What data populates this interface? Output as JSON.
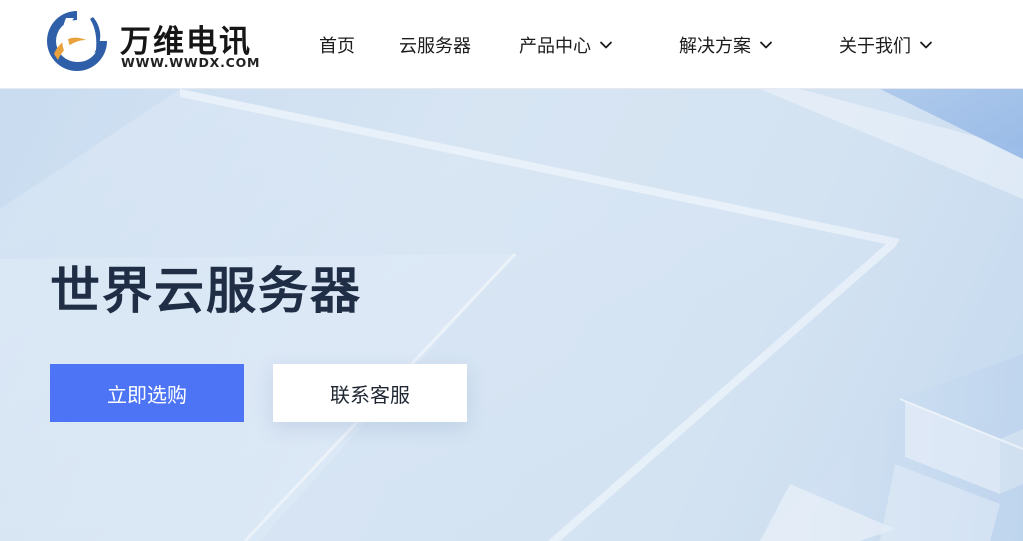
{
  "brand": {
    "name": "万维电讯",
    "domain": "WWW.WWDX.COM",
    "colors": {
      "blue": "#2f5fa8",
      "orange": "#e9a23b"
    }
  },
  "nav": {
    "items": [
      {
        "label": "首页",
        "has_dropdown": false
      },
      {
        "label": "云服务器",
        "has_dropdown": false
      },
      {
        "label": "产品中心",
        "has_dropdown": true
      },
      {
        "label": "解决方案",
        "has_dropdown": true
      },
      {
        "label": "关于我们",
        "has_dropdown": true
      }
    ],
    "dropdown_icon": "chevron-down-icon"
  },
  "hero": {
    "title": "世界云服务器",
    "primary_button": "立即选购",
    "secondary_button": "联系客服",
    "colors": {
      "primary": "#4d74f5",
      "title": "#1f2d45"
    }
  }
}
